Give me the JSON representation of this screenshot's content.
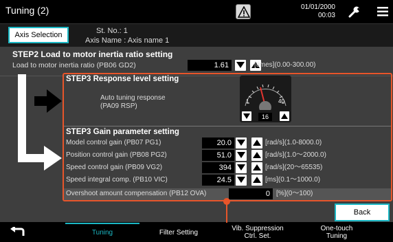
{
  "header": {
    "title": "Tuning (2)",
    "date": "01/01/2000",
    "time": "00:03",
    "icons": [
      "warning-icon",
      "wrench-icon",
      "menu-icon"
    ]
  },
  "axis": {
    "button_label": "Axis Selection",
    "station": "St. No.:  1",
    "axis_name": "Axis Name : Axis name 1"
  },
  "step2": {
    "title": "STEP2 Load to motor inertia ratio setting",
    "label": "Load to motor inertia ratio (PB06 GD2)",
    "value": "1.61",
    "unit": "[times](0.00-300.00)"
  },
  "step3_response": {
    "title": "STEP3 Response level setting",
    "label_line1": "Auto tuning response",
    "label_line2": "(PA09 RSP)",
    "gauge_min": "1",
    "gauge_max": "40",
    "value": "16"
  },
  "step3_gain": {
    "title": "STEP3 Gain parameter setting",
    "rows": [
      {
        "label": "Model control gain (PB07 PG1)",
        "value": "20.0",
        "unit": "[rad/s](1.0-8000.0)"
      },
      {
        "label": "Position control gain (PB08 PG2)",
        "value": "51.0",
        "unit": "[rad/s](1.0～2000.0)"
      },
      {
        "label": "Speed control gain (PB09 VG2)",
        "value": "394",
        "unit": "[rad/s](20～65535)"
      },
      {
        "label": "Speed integral comp. (PB10 VIC)",
        "value": "24.5",
        "unit": "[ms](0.1～1000.0)"
      }
    ]
  },
  "overshoot": {
    "label": "Overshoot amount compensation (PB12 OVA)",
    "value": "0",
    "unit": "[%](0～100)"
  },
  "back_label": "Back",
  "tabs": [
    {
      "label": "Tuning",
      "active": true
    },
    {
      "label": "Filter Setting",
      "active": false
    },
    {
      "label_line1": "Vib. Suppression",
      "label_line2": "Ctrl. Set.",
      "active": false
    },
    {
      "label_line1": "One-touch",
      "label_line2": "Tuning",
      "active": false
    }
  ],
  "colors": {
    "accent": "#1bb7c4",
    "highlight": "#e8552a"
  }
}
